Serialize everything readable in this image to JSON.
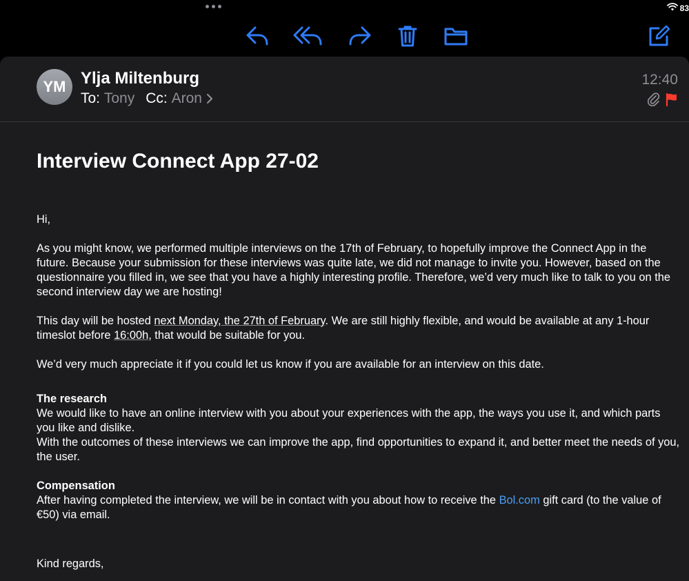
{
  "status": {
    "battery": "83"
  },
  "message": {
    "avatar_initials": "YM",
    "sender": "Ylja Miltenburg",
    "to_label": "To:",
    "to": "Tony",
    "cc_label": "Cc:",
    "cc": "Aron",
    "time": "12:40",
    "subject": "Interview Connect App 27-02",
    "greeting": "Hi,",
    "p1": "As you might know, we performed multiple interviews on the 17th of February, to hopefully improve the Connect App in the future. Because your submission for these interviews was quite late, we did not manage to invite you. However, based on the questionnaire you filled in, we see that you have a highly interesting profile. Therefore, we’d very much like to talk to you on the second interview day we are hosting!",
    "p2_a": "This day will be hosted ",
    "p2_date": "next Monday, the 27th of February",
    "p2_b": ". We are still highly flexible, and would be available at any 1-hour timeslot before ",
    "p2_time": "16:00h",
    "p2_c": ", that would be suitable for you.",
    "p3": "We’d very much appreciate it if you could let us know if you are available for an interview on this date.",
    "research_heading": "The research",
    "research_1": "We would like to have an online interview with you about your experiences with the app, the ways you use it, and which parts you like and dislike.",
    "research_2": "With the outcomes of these interviews we can improve the app, find opportunities to expand it, and better meet the needs of you, the user.",
    "comp_heading": "Compensation",
    "comp_a": "After having completed the interview, we will be in contact with you about how to receive the ",
    "comp_link": "Bol.com",
    "comp_b": " gift card (to the value of €50) via email.",
    "signoff": "Kind regards,"
  },
  "colors": {
    "accent": "#2f7cf6",
    "link": "#4a9ff5",
    "flag": "#ff3b30",
    "secondary_text": "#8e8e93"
  }
}
